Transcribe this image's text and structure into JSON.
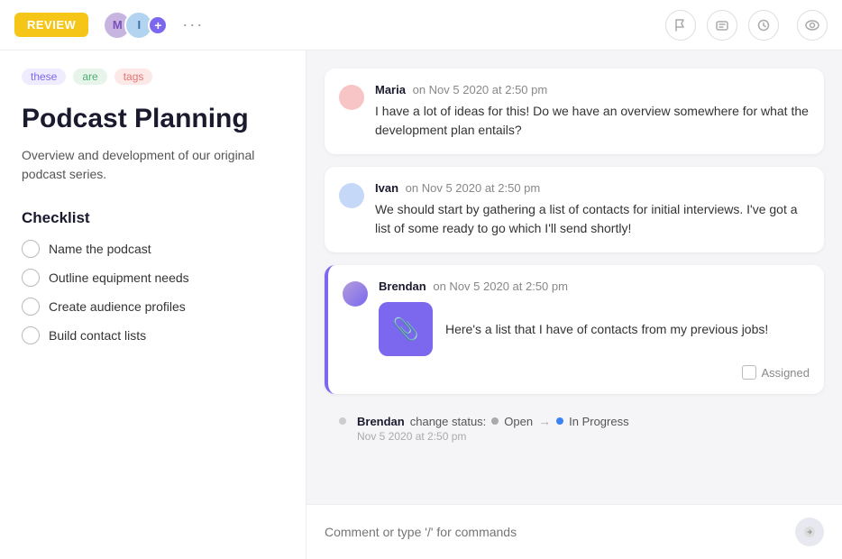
{
  "topbar": {
    "review_label": "REVIEW",
    "ellipsis": "···",
    "tabs": [
      {
        "icon": "⚑",
        "label": "flag-icon",
        "active": false
      },
      {
        "icon": "▭",
        "label": "card-icon",
        "active": false
      },
      {
        "icon": "◷",
        "label": "clock-icon",
        "active": false
      }
    ],
    "eye_icon": "◉"
  },
  "left": {
    "tags": [
      {
        "label": "these",
        "style": "purple"
      },
      {
        "label": "are",
        "style": "green"
      },
      {
        "label": "tags",
        "style": "red"
      }
    ],
    "title": "Podcast Planning",
    "description": "Overview and development of our original podcast series.",
    "checklist_title": "Checklist",
    "checklist_items": [
      {
        "label": "Name the podcast"
      },
      {
        "label": "Outline equipment needs"
      },
      {
        "label": "Create audience profiles"
      },
      {
        "label": "Build contact lists"
      }
    ]
  },
  "right": {
    "comments": [
      {
        "author": "Maria",
        "timestamp": "on Nov 5 2020 at 2:50 pm",
        "text": "I have a lot of ideas for this! Do we have an overview somewhere for what the development plan entails?",
        "avatar_style": "pink",
        "highlighted": false
      },
      {
        "author": "Ivan",
        "timestamp": "on Nov 5 2020 at 2:50 pm",
        "text": "We should start by gathering a list of contacts for initial interviews. I've got a list of some ready to go which I'll send shortly!",
        "avatar_style": "blue",
        "highlighted": false
      }
    ],
    "highlighted_comment": {
      "author": "Brendan",
      "timestamp": "on Nov 5 2020 at 2:50 pm",
      "text": "Here's a list that I have of contacts from my previous jobs!",
      "attachment_icon": "📎",
      "assigned_label": "Assigned"
    },
    "status_change": {
      "author": "Brendan",
      "action": "change status:",
      "from_status": "Open",
      "to_status": "In Progress",
      "timestamp": "Nov 5 2020 at 2:50 pm"
    },
    "comment_placeholder": "Comment or type '/' for commands"
  }
}
